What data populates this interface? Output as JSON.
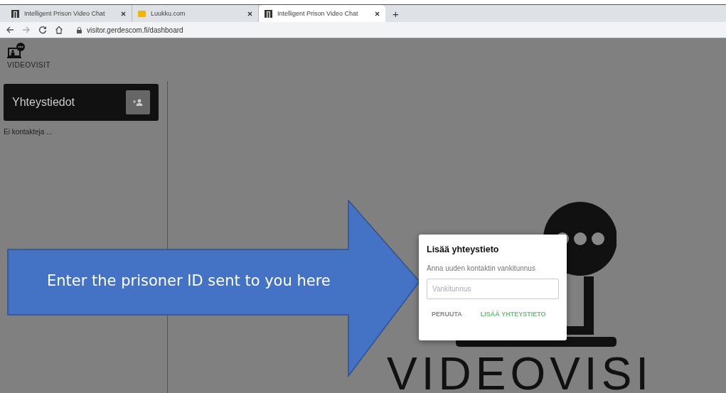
{
  "browser": {
    "tabs": [
      {
        "title": "Intelligent Prison Video Chat",
        "kind": "app",
        "selected": false
      },
      {
        "title": "Luukku.com",
        "kind": "mail",
        "selected": false
      },
      {
        "title": "Intelligent Prison Video Chat",
        "kind": "app",
        "selected": true
      }
    ],
    "new_tab": "+",
    "url": "visitor.gerdescom.fi/dashboard"
  },
  "logo": {
    "text": "VIDEOVISIT"
  },
  "sidebar": {
    "title": "Yhteystiedot",
    "empty_text": "Ei kontakteja ..."
  },
  "background_logo": {
    "text": "VIDEOVISI"
  },
  "callout": {
    "text": "Enter the prisoner ID sent to you here"
  },
  "dialog": {
    "title": "Lisää yhteystieto",
    "description": "Anna uuden kontaktin vankitunnus",
    "placeholder": "Vankitunnus",
    "buttons": [
      {
        "label": "PERUUTA",
        "kind": "cancel"
      },
      {
        "label": "LISÄÄ YHTEYSTIETO",
        "kind": "confirm"
      }
    ]
  }
}
